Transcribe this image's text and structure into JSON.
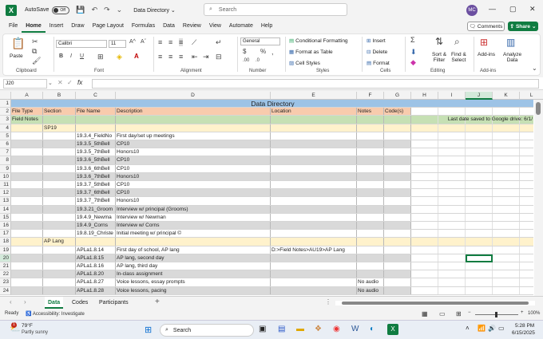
{
  "titlebar": {
    "autosave_label": "AutoSave",
    "autosave_state": "Off",
    "doc_title": "Data Directory",
    "search_placeholder": "Search",
    "avatar_initials": "MC"
  },
  "menu_tabs": [
    "File",
    "Home",
    "Insert",
    "Draw",
    "Page Layout",
    "Formulas",
    "Data",
    "Review",
    "View",
    "Automate",
    "Help"
  ],
  "active_tab": "Home",
  "comments_label": "Comments",
  "share_label": "Share",
  "ribbon": {
    "clipboard": {
      "paste": "Paste",
      "label": "Clipboard"
    },
    "font": {
      "family": "Calibri",
      "size": "11",
      "label": "Font",
      "bold": "B",
      "italic": "I",
      "underline": "U"
    },
    "alignment": {
      "label": "Alignment"
    },
    "number": {
      "format": "General",
      "label": "Number",
      "currency": "$",
      "percent": "%"
    },
    "styles": {
      "cond": "Conditional Formatting",
      "table": "Format as Table",
      "cell": "Cell Styles",
      "label": "Styles"
    },
    "cells": {
      "insert": "Insert",
      "delete": "Delete",
      "format": "Format",
      "label": "Cells"
    },
    "editing": {
      "sum": "Σ",
      "sort": "Sort &",
      "sort2": "Filter",
      "find": "Find &",
      "find2": "Select",
      "label": "Editing"
    },
    "addins": {
      "addins": "Add-ins",
      "analyze": "Analyze",
      "analyze2": "Data",
      "label": "Add-ins"
    }
  },
  "formula_bar": {
    "name_box": "J20",
    "fx": "fx",
    "value": ""
  },
  "columns": [
    "A",
    "B",
    "C",
    "D",
    "E",
    "F",
    "G",
    "H",
    "I",
    "J",
    "K",
    "L"
  ],
  "rows": [
    {
      "n": "1",
      "cells": {
        "D": "Data Directory"
      },
      "type": "title"
    },
    {
      "n": "2",
      "cells": {
        "A": "File Type",
        "B": "Section",
        "C": "File Name",
        "D": "Description",
        "E": "Location",
        "F": "Notes",
        "G": "Code(s)"
      },
      "type": "header"
    },
    {
      "n": "3",
      "cells": {
        "A": "Field Notes",
        "K": "Last date saved to Google drive: 6/1/"
      },
      "type": "green"
    },
    {
      "n": "4",
      "cells": {
        "B": "SP19"
      },
      "type": "yellow"
    },
    {
      "n": "5",
      "cells": {
        "C": "19.3.4_FieldNo",
        "D": "First day/set up meetings"
      },
      "type": "plain"
    },
    {
      "n": "6",
      "cells": {
        "C": "19.3.5_5thBell",
        "D": "CP10"
      },
      "type": "grey"
    },
    {
      "n": "7",
      "cells": {
        "C": "19.3.5_7thBell",
        "D": "Honors10"
      },
      "type": "plain"
    },
    {
      "n": "8",
      "cells": {
        "C": "19.3.6_5thBell",
        "D": "CP10"
      },
      "type": "grey"
    },
    {
      "n": "9",
      "cells": {
        "C": "19.3.6_6thBell",
        "D": "CP10"
      },
      "type": "plain"
    },
    {
      "n": "10",
      "cells": {
        "C": "19.3.6_7thBell",
        "D": "Honors10"
      },
      "type": "grey"
    },
    {
      "n": "11",
      "cells": {
        "C": "19.3.7_5thBell",
        "D": "CP10"
      },
      "type": "plain"
    },
    {
      "n": "12",
      "cells": {
        "C": "19.3.7_6thBell",
        "D": "CP10"
      },
      "type": "grey"
    },
    {
      "n": "13",
      "cells": {
        "C": "19.3.7_7thBell",
        "D": "Honors10"
      },
      "type": "plain"
    },
    {
      "n": "14",
      "cells": {
        "C": "19.3.21_Groom",
        "D": "Interview w/ principal (Grooms)"
      },
      "type": "grey"
    },
    {
      "n": "15",
      "cells": {
        "C": "19.4.9_Newma",
        "D": "Interview w/ Newman"
      },
      "type": "plain"
    },
    {
      "n": "16",
      "cells": {
        "C": "19.4.9_Corns",
        "D": "Interview w/ Corns"
      },
      "type": "grey"
    },
    {
      "n": "17",
      "cells": {
        "C": "19.8.19_Christe",
        "D": "Initial meeting w/ principal ©"
      },
      "type": "plain"
    },
    {
      "n": "18",
      "cells": {
        "B": "AP Lang"
      },
      "type": "yellow"
    },
    {
      "n": "19",
      "cells": {
        "C": "APLa1.8.14",
        "D": "First day of school, AP lang",
        "E": "D:>Field Notes>AU19>AP Lang"
      },
      "type": "plain"
    },
    {
      "n": "20",
      "cells": {
        "C": "APLa1.8.15",
        "D": "AP lang, second day"
      },
      "type": "grey"
    },
    {
      "n": "21",
      "cells": {
        "C": "APLa1.8.16",
        "D": "AP lang, third day"
      },
      "type": "plain"
    },
    {
      "n": "22",
      "cells": {
        "C": "APLa1.8.20",
        "D": "In-class assignment"
      },
      "type": "grey"
    },
    {
      "n": "23",
      "cells": {
        "C": "APLa1.8.27",
        "D": "Voice lessons, essay prompts",
        "F": "No audio"
      },
      "type": "plain"
    },
    {
      "n": "24",
      "cells": {
        "C": "APLa1.8.28",
        "D": "Voice lessons, pacing",
        "F": "No audio"
      },
      "type": "grey"
    }
  ],
  "sheets": [
    "Data",
    "Codes",
    "Participants"
  ],
  "active_sheet": "Data",
  "status": {
    "ready": "Ready",
    "accessibility": "Accessibility: Investigate",
    "zoom": "100%"
  },
  "taskbar": {
    "temp": "79°F",
    "weather": "Partly sunny",
    "search": "Search",
    "time": "5:28 PM",
    "date": "6/15/2025",
    "badge": "1"
  },
  "colors": {
    "excel_green": "#107c41",
    "header_blue": "#9dc3e6",
    "header_orange": "#f8cbad",
    "green_row": "#c6e0b4",
    "yellow_row": "#fff2cc",
    "grey_row": "#d9d9d9"
  }
}
